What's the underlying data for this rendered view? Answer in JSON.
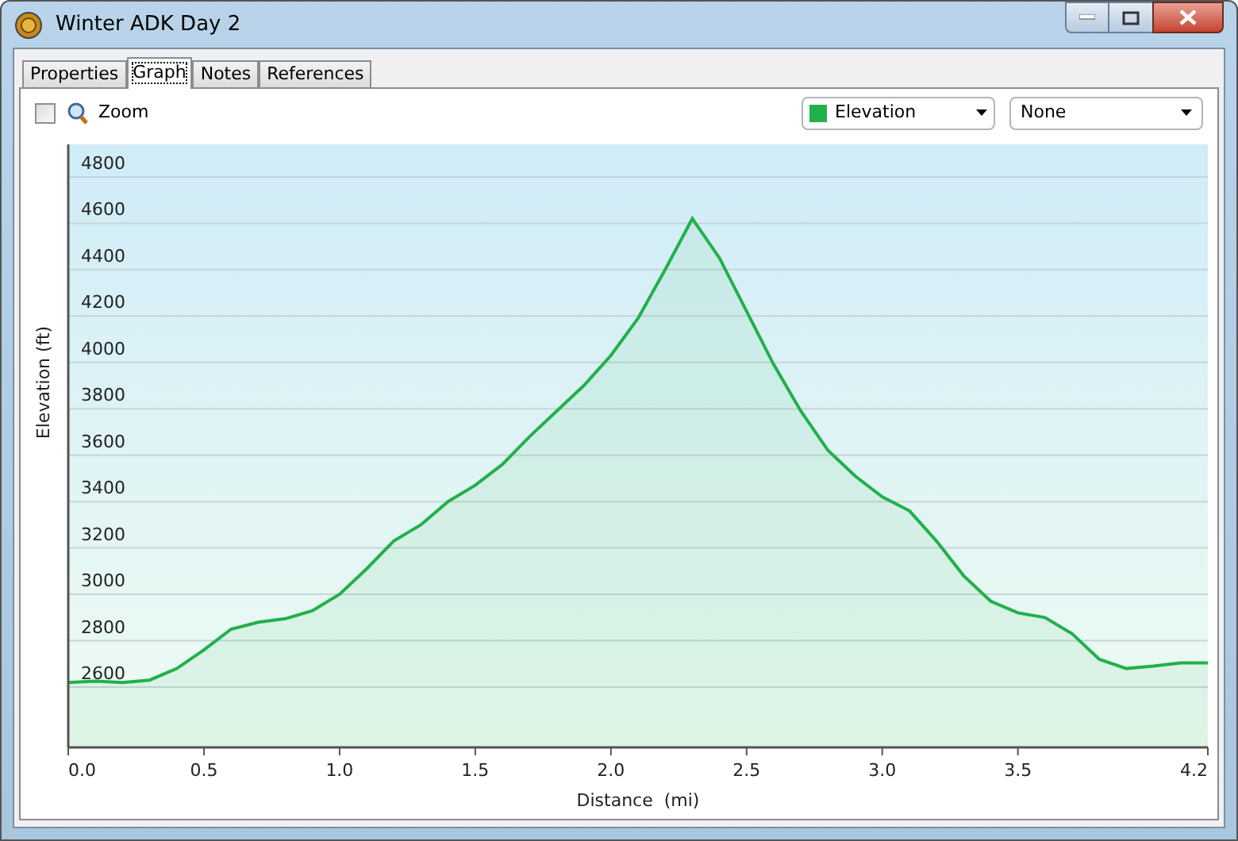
{
  "window": {
    "title": "Winter ADK Day 2"
  },
  "tabs": [
    {
      "label": "Properties",
      "selected": false
    },
    {
      "label": "Graph",
      "selected": true
    },
    {
      "label": "Notes",
      "selected": false
    },
    {
      "label": "References",
      "selected": false
    }
  ],
  "toolbar": {
    "zoom": {
      "label": "Zoom",
      "checked": false
    },
    "secondary_dropdown": {
      "value": "None"
    }
  },
  "graph": {
    "chart_data": {
      "type": "area",
      "xlabel": "Distance  (mi)",
      "ylabel": "Elevation (ft)",
      "x": [
        0.0,
        0.1,
        0.2,
        0.3,
        0.4,
        0.5,
        0.6,
        0.7,
        0.8,
        0.9,
        1.0,
        1.1,
        1.2,
        1.3,
        1.4,
        1.5,
        1.6,
        1.7,
        1.8,
        1.9,
        2.0,
        2.1,
        2.2,
        2.3,
        2.4,
        2.5,
        2.6,
        2.7,
        2.8,
        2.9,
        3.0,
        3.1,
        3.2,
        3.3,
        3.4,
        3.5,
        3.6,
        3.7,
        3.8,
        3.9,
        4.0,
        4.1,
        4.2
      ],
      "series": [
        {
          "name": "Elevation",
          "color": "#22b04a",
          "values": [
            2620,
            2625,
            2620,
            2630,
            2680,
            2760,
            2850,
            2880,
            2895,
            2930,
            3000,
            3110,
            3230,
            3300,
            3400,
            3470,
            3560,
            3680,
            3790,
            3900,
            4030,
            4190,
            4400,
            4620,
            4450,
            4220,
            3990,
            3790,
            3620,
            3510,
            3420,
            3360,
            3230,
            3080,
            2970,
            2920,
            2900,
            2830,
            2720,
            2680,
            2690,
            2705,
            2705
          ]
        }
      ],
      "grid": true,
      "xlim": [
        0,
        4.2
      ],
      "ylim": [
        2340,
        4940
      ],
      "xticks": [
        {
          "value": 0,
          "label": "0.0"
        },
        {
          "value": 0.5,
          "label": "0.5"
        },
        {
          "value": 1,
          "label": "1.0"
        },
        {
          "value": 1.5,
          "label": "1.5"
        },
        {
          "value": 2,
          "label": "2.0"
        },
        {
          "value": 2.5,
          "label": "2.5"
        },
        {
          "value": 3,
          "label": "3.0"
        },
        {
          "value": 3.5,
          "label": "3.5"
        },
        {
          "value": 4.2,
          "label": "4.2"
        }
      ],
      "yticks": [
        2600,
        2800,
        3000,
        3200,
        3400,
        3600,
        3800,
        4000,
        4200,
        4400,
        4600,
        4800
      ]
    }
  }
}
